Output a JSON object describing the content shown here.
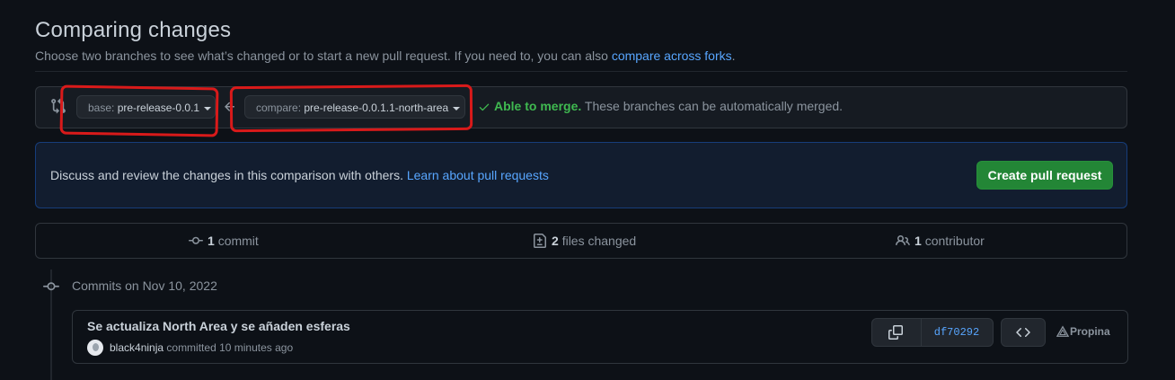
{
  "header": {
    "title": "Comparing changes",
    "subtitle_text": "Choose two branches to see what’s changed or to start a new pull request. If you need to, you can also",
    "subtitle_link": "compare across forks",
    "subtitle_end": "."
  },
  "range_editor": {
    "base_label": "base:",
    "base_branch": "pre-release-0.0.1",
    "compare_label": "compare:",
    "compare_branch": "pre-release-0.0.1.1-north-area",
    "merge_status": "Able to merge.",
    "merge_detail": "These branches can be automatically merged."
  },
  "flash": {
    "message": "Discuss and review the changes in this comparison with others.",
    "link": "Learn about pull requests",
    "button": "Create pull request"
  },
  "stats": {
    "commits_count": "1",
    "commits_label": "commit",
    "files_count": "2",
    "files_label": "files changed",
    "contributors_count": "1",
    "contributors_label": "contributor"
  },
  "commits": {
    "group_heading": "Commits on Nov 10, 2022",
    "items": [
      {
        "message": "Se actualiza North Area y se añaden esferas",
        "author": "black4ninja",
        "meta": "committed 10 minutes ago",
        "sha": "df70292",
        "extra": "Propina"
      }
    ]
  },
  "colors": {
    "background": "#0d1117",
    "accent_link": "#58a6ff",
    "success": "#3fb950",
    "button_green": "#238636",
    "annotation_red": "#d91a1a"
  },
  "icons": [
    "git-compare-icon",
    "arrow-left-icon",
    "check-icon",
    "commit-icon",
    "file-diff-icon",
    "people-icon",
    "copy-icon",
    "code-icon",
    "triangle-icon"
  ]
}
